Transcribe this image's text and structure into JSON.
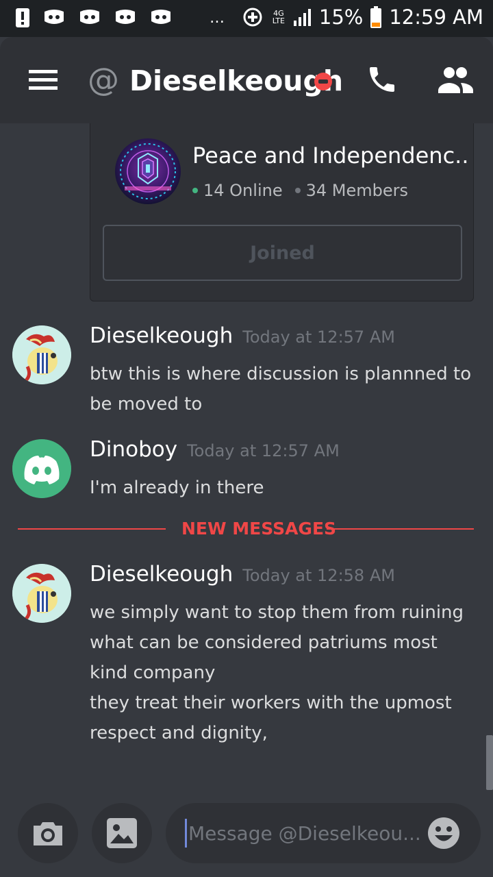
{
  "status_bar": {
    "network": "4G LTE",
    "battery": "15%",
    "time": "12:59 AM",
    "overflow": "…"
  },
  "header": {
    "at_symbol": "@",
    "title": "Dieselkeough",
    "status_color": "#f04747"
  },
  "invite": {
    "guild_name": "Peace and Independenc..",
    "online": "14 Online",
    "members": "34 Members",
    "button_label": "Joined"
  },
  "messages": [
    {
      "author": "Dieselkeough",
      "timestamp": "Today at 12:57 AM",
      "lines": [
        "btw this is where discussion is plannned to be moved to"
      ]
    },
    {
      "author": "Dinoboy",
      "timestamp": "Today at 12:57 AM",
      "lines": [
        "I'm already in there"
      ]
    },
    {
      "author": "Dieselkeough",
      "timestamp": "Today at 12:58 AM",
      "lines": [
        "we simply want to stop them from ruining what can be considered patriums most kind company",
        "they treat their workers with the upmost respect and dignity,"
      ]
    }
  ],
  "divider_label": "NEW MESSAGES",
  "composer": {
    "placeholder": "Message @Dieselkeou..."
  },
  "colors": {
    "background": "#36393f",
    "header": "#2f3136",
    "status_bar": "#1e2124",
    "online": "#43b581",
    "accent": "#7289da",
    "new_messages": "#f04747"
  }
}
